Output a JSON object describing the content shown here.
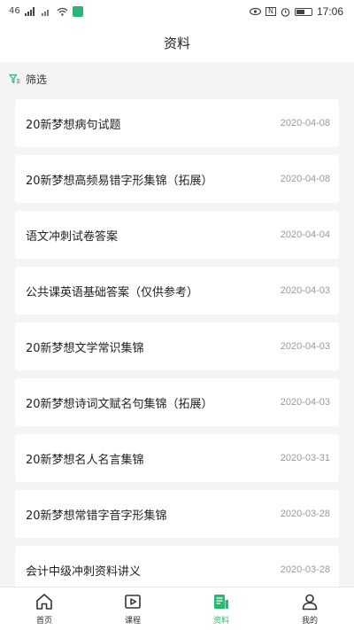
{
  "status_bar": {
    "signal_text": "46",
    "time": "17:06",
    "nfc_text": "N"
  },
  "header": {
    "title": "资料"
  },
  "filter": {
    "label": "筛选"
  },
  "items": [
    {
      "title": "20新梦想病句试题",
      "date": "2020-04-08"
    },
    {
      "title": "20新梦想高频易错字形集锦（拓展）",
      "date": "2020-04-08"
    },
    {
      "title": "语文冲刺试卷答案",
      "date": "2020-04-04"
    },
    {
      "title": "公共课英语基础答案（仅供参考）",
      "date": "2020-04-03"
    },
    {
      "title": "20新梦想文学常识集锦",
      "date": "2020-04-03"
    },
    {
      "title": "20新梦想诗词文赋名句集锦（拓展）",
      "date": "2020-04-03"
    },
    {
      "title": "20新梦想名人名言集锦",
      "date": "2020-03-31"
    },
    {
      "title": "20新梦想常错字音字形集锦",
      "date": "2020-03-28"
    },
    {
      "title": "会计中级冲刺资料讲义",
      "date": "2020-03-28"
    }
  ],
  "tabs": [
    {
      "label": "首页",
      "icon": "home-icon"
    },
    {
      "label": "课程",
      "icon": "play-course-icon"
    },
    {
      "label": "资料",
      "icon": "document-icon",
      "active": true
    },
    {
      "label": "我的",
      "icon": "user-icon"
    }
  ],
  "colors": {
    "accent": "#2bb673",
    "background": "#f4f4f4",
    "date_text": "#999999"
  }
}
